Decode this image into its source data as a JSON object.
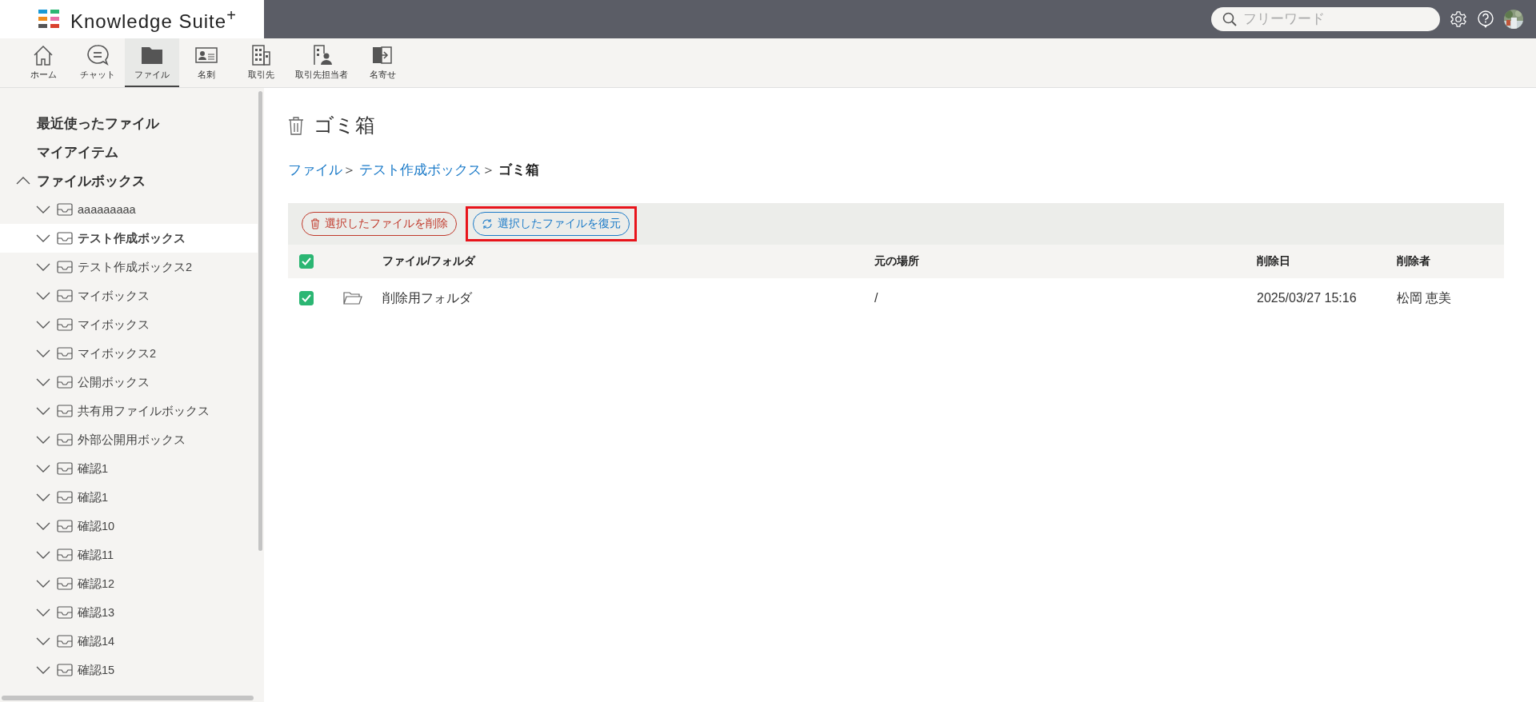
{
  "header": {
    "logo": "Knowledge Suite$^{+}$",
    "search": {
      "placeholder": "フリーワード"
    }
  },
  "nav": [
    {
      "label": "ホーム",
      "kind": "home",
      "selected": false
    },
    {
      "label": "チャット",
      "kind": "chat",
      "selected": false
    },
    {
      "label": "ファイル",
      "kind": "folder",
      "selected": true
    },
    {
      "label": "名刺",
      "kind": "card",
      "selected": false
    },
    {
      "label": "取引先",
      "kind": "building",
      "selected": false
    },
    {
      "label": "取引先担当者",
      "kind": "contact",
      "selected": false
    },
    {
      "label": "名寄せ",
      "kind": "merge",
      "selected": false
    }
  ],
  "sidebar": {
    "items": [
      {
        "label": "最近使ったファイル"
      },
      {
        "label": "マイアイテム"
      },
      {
        "label": "ファイルボックス",
        "expanded": true,
        "children": [
          {
            "label": "aaaaaaaaa",
            "expanded": false,
            "selected": false
          },
          {
            "label": "テスト作成ボックス",
            "expanded": false,
            "selected": true
          },
          {
            "label": "テスト作成ボックス2",
            "expanded": false,
            "selected": false
          },
          {
            "label": "マイボックス",
            "expanded": false,
            "selected": false
          },
          {
            "label": "マイボックス",
            "expanded": false,
            "selected": false
          },
          {
            "label": "マイボックス2",
            "expanded": false,
            "selected": false
          },
          {
            "label": "公開ボックス",
            "expanded": false,
            "selected": false
          },
          {
            "label": "共有用ファイルボックス",
            "expanded": false,
            "selected": false
          },
          {
            "label": "外部公開用ボックス",
            "expanded": false,
            "selected": false
          },
          {
            "label": "確認1",
            "expanded": false,
            "selected": false
          },
          {
            "label": "確認1",
            "expanded": false,
            "selected": false
          },
          {
            "label": "確認10",
            "expanded": false,
            "selected": false
          },
          {
            "label": "確認11",
            "expanded": false,
            "selected": false
          },
          {
            "label": "確認12",
            "expanded": false,
            "selected": false
          },
          {
            "label": "確認13",
            "expanded": false,
            "selected": false
          },
          {
            "label": "確認14",
            "expanded": false,
            "selected": false
          },
          {
            "label": "確認15",
            "expanded": false,
            "selected": false
          }
        ]
      }
    ]
  },
  "page": {
    "title": "ゴミ箱",
    "breadcrumb": [
      {
        "label": "ファイル",
        "sep": "＞",
        "link": true
      },
      {
        "label": "テスト作成ボックス",
        "sep": "＞",
        "link": true
      },
      {
        "label": "ゴミ箱",
        "link": false
      }
    ],
    "actions": [
      {
        "kind": "delete",
        "label": "選択したファイルを削除",
        "highlighted": false
      },
      {
        "kind": "restore",
        "label": "選択したファイルを復元",
        "highlighted": true
      }
    ],
    "table": {
      "all_checked": true,
      "columns": [
        "ファイル/フォルダ",
        "元の場所",
        "削除日",
        "削除者"
      ],
      "rows": [
        {
          "checked": true,
          "kind": "folder",
          "name": "削除用フォルダ",
          "location": "/",
          "deleted_at": "2025/03/27 15:16",
          "deleted_by": "松岡 恵美"
        }
      ]
    }
  }
}
